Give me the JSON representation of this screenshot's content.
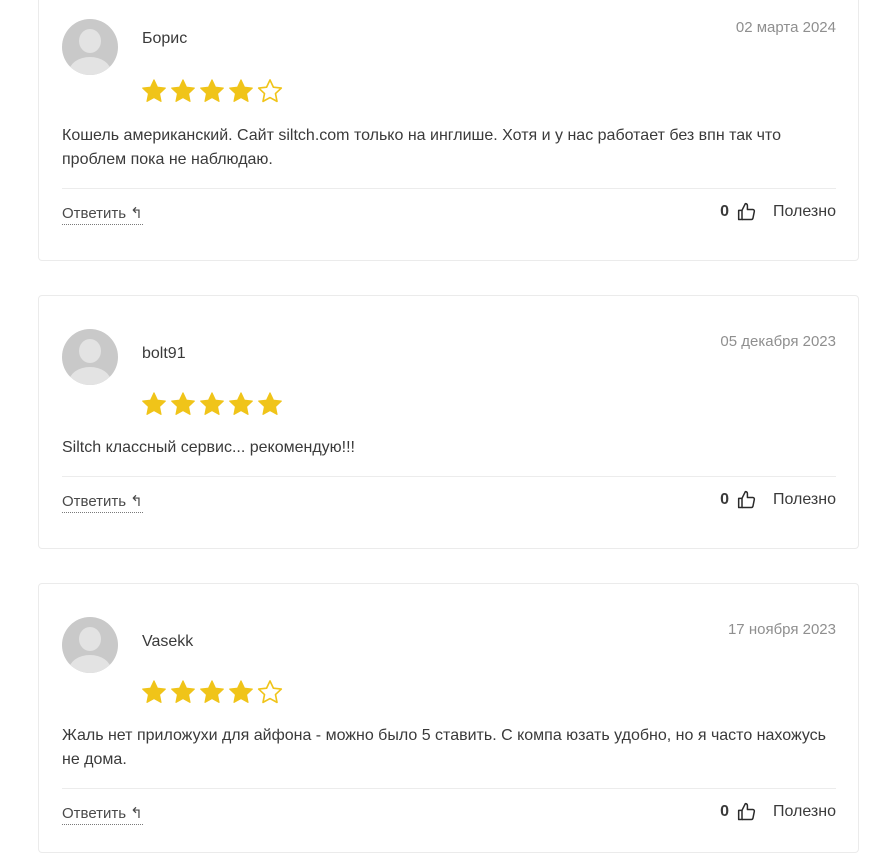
{
  "reviews": [
    {
      "author": "Борис",
      "date": "02 марта 2024",
      "rating": 4,
      "max_rating": 5,
      "text": "Кошель американский. Сайт siltch.com только на инглише. Хотя и у нас работает без впн так что проблем пока не наблюдаю.",
      "reply_label": "Ответить",
      "helpful_count": "0",
      "helpful_label": "Полезно"
    },
    {
      "author": "bolt91",
      "date": "05 декабря 2023",
      "rating": 5,
      "max_rating": 5,
      "text": "Siltch классный сервис... рекомендую!!!",
      "reply_label": "Ответить",
      "helpful_count": "0",
      "helpful_label": "Полезно"
    },
    {
      "author": "Vasekk",
      "date": "17 ноября 2023",
      "rating": 4,
      "max_rating": 5,
      "text": "Жаль нет приложухи для айфона - можно было 5 ставить. С компа юзать удобно, но я часто нахожусь не дома.",
      "reply_label": "Ответить",
      "helpful_count": "0",
      "helpful_label": "Полезно"
    }
  ],
  "colors": {
    "star_filled": "#f0c419",
    "star_empty_stroke": "#f0c419",
    "border": "#ebebeb",
    "date": "#8f8f8f"
  },
  "icons": {
    "reply": "reply-arrow-icon",
    "helpful": "thumbs-up-icon",
    "avatar": "default-user-avatar-icon"
  }
}
